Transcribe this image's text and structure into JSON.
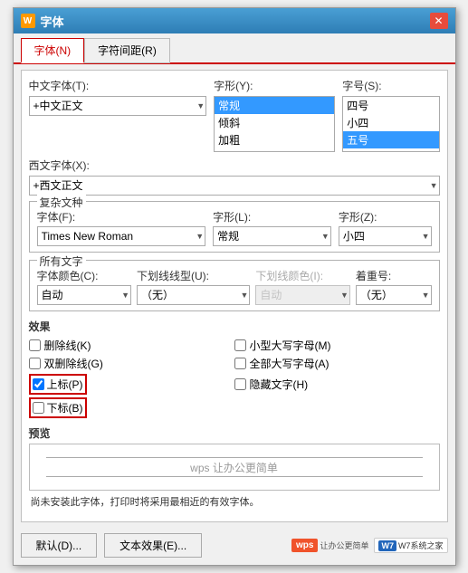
{
  "window": {
    "title": "字体",
    "icon": "W"
  },
  "tabs": [
    {
      "id": "font",
      "label": "字体(N)",
      "active": true
    },
    {
      "id": "spacing",
      "label": "字符间距(R)",
      "active": false
    }
  ],
  "chinese_font_section": {
    "label": "中文字体(T):",
    "value": "+中文正文"
  },
  "font_style_section": {
    "label": "字形(Y):",
    "options": [
      "常规",
      "倾斜",
      "加粗"
    ],
    "selected": "常规"
  },
  "font_size_section": {
    "label": "字号(S):",
    "options": [
      "四号",
      "小四",
      "五号"
    ],
    "selected": "五号"
  },
  "western_font_section": {
    "label": "西文字体(X):",
    "value": "+西文正文"
  },
  "fuze_section": {
    "title": "复杂文种",
    "font_label": "字体(F):",
    "font_value": "Times New Roman",
    "style_label": "字形(L):",
    "style_value": "常规",
    "size_label": "字形(Z):",
    "size_value": "小四"
  },
  "all_text_section": {
    "title": "所有文字",
    "color_label": "字体颜色(C):",
    "color_value": "自动",
    "underline_label": "下划线线型(U):",
    "underline_value": "（无）",
    "underline_color_label": "下划线颜色(I):",
    "underline_color_value": "自动",
    "emphasis_label": "着重号:",
    "emphasis_value": "（无）"
  },
  "effects_section": {
    "title": "效果",
    "items_left": [
      {
        "id": "strikethrough",
        "label": "删除线(K)",
        "checked": false
      },
      {
        "id": "double_strikethrough",
        "label": "双删除线(G)",
        "checked": false
      },
      {
        "id": "superscript",
        "label": "上标(P)",
        "checked": true,
        "highlight": true
      },
      {
        "id": "subscript",
        "label": "下标(B)",
        "checked": false,
        "highlight": true
      }
    ],
    "items_right": [
      {
        "id": "small_caps",
        "label": "小型大写字母(M)",
        "checked": false
      },
      {
        "id": "all_caps",
        "label": "全部大写字母(A)",
        "checked": false
      },
      {
        "id": "hidden",
        "label": "隐藏文字(H)",
        "checked": false
      }
    ]
  },
  "preview_section": {
    "title": "预览",
    "content": "wps 让办公更简单"
  },
  "note_text": "尚未安装此字体，打印时将采用最相近的有效字体。",
  "buttons": {
    "default": "默认(D)...",
    "text_effect": "文本效果(E)..."
  },
  "watermark": {
    "wps": "wps",
    "w7": "W7系统之家"
  }
}
